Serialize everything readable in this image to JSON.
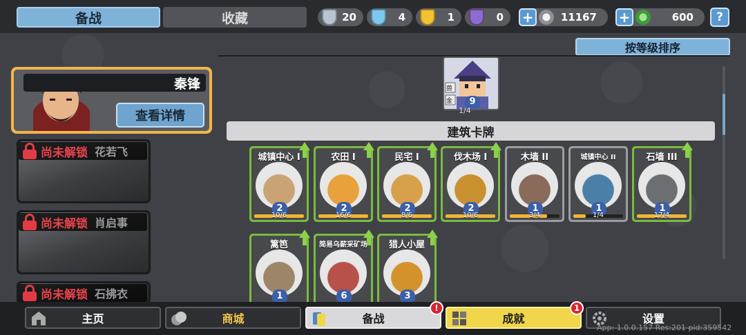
{
  "tabs": {
    "active": "备战",
    "inactive": "收藏"
  },
  "resources": [
    {
      "name": "silver-shield",
      "value": "20",
      "color": "#b9c3d2"
    },
    {
      "name": "crystal-shield",
      "value": "4",
      "color": "#7ec8ee"
    },
    {
      "name": "gold-shield",
      "value": "1",
      "color": "#f1c232"
    },
    {
      "name": "purple-shield",
      "value": "0",
      "color": "#8e6bd0"
    }
  ],
  "currency": {
    "coins": "11167",
    "gems": "600"
  },
  "help_label": "?",
  "heroes": {
    "active": {
      "name": "秦锋",
      "detail_label": "查看详情"
    },
    "locked": [
      {
        "status": "尚未解锁",
        "name": "花若飞"
      },
      {
        "status": "尚未解锁",
        "name": "肖启事"
      },
      {
        "status": "尚未解锁",
        "name": "石拂衣"
      }
    ]
  },
  "sort_label": "按等级排序",
  "army_card": {
    "level": "9",
    "count": "1/4",
    "tags": [
      "兽",
      "金"
    ]
  },
  "section_title": "建筑卡牌",
  "cards": [
    {
      "title": "城镇中心 I",
      "level": "2",
      "progress": "10/6",
      "fill": 1.0,
      "upgradable": true,
      "art": "#c9a276"
    },
    {
      "title": "农田 I",
      "level": "2",
      "progress": "16/6",
      "fill": 1.0,
      "upgradable": true,
      "art": "#e9a13b"
    },
    {
      "title": "民宅 I",
      "level": "2",
      "progress": "8/6",
      "fill": 1.0,
      "upgradable": true,
      "art": "#d7a04a"
    },
    {
      "title": "伐木场 I",
      "level": "2",
      "progress": "10/6",
      "fill": 1.0,
      "upgradable": true,
      "art": "#c8902f"
    },
    {
      "title": "木墙 II",
      "level": "1",
      "progress": "3/4",
      "fill": 0.75,
      "upgradable": false,
      "art": "#8a6a5a"
    },
    {
      "title": "城镇中心 II",
      "level": "1",
      "progress": "1/4",
      "fill": 0.25,
      "upgradable": false,
      "art": "#4b7fa8"
    },
    {
      "title": "石墙 III",
      "level": "1",
      "progress": "17/4",
      "fill": 1.0,
      "upgradable": true,
      "art": "#6c6f71"
    },
    {
      "title": "篱笆",
      "level": "1",
      "progress": "",
      "fill": 0,
      "upgradable": true,
      "art": "#9c8569"
    },
    {
      "title": "简易乌薪采矿场",
      "level": "6",
      "progress": "",
      "fill": 0,
      "upgradable": true,
      "art": "#b8514a"
    },
    {
      "title": "猎人小屋",
      "level": "3",
      "progress": "",
      "fill": 0,
      "upgradable": true,
      "art": "#d3922c"
    }
  ],
  "nav": {
    "home": "主页",
    "shop": "商城",
    "prepare": "备战",
    "achievement": "成就",
    "settings": "设置",
    "prepare_badge": "!",
    "achievement_badge": "1"
  },
  "version": "App: 1.0.0.157 Res:201 pid:359542"
}
